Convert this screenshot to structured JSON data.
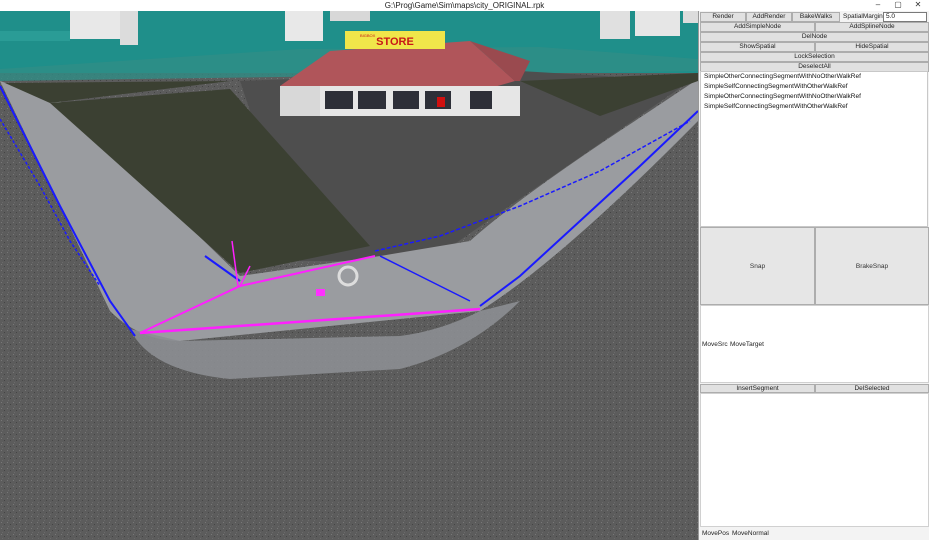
{
  "window": {
    "title": "G:\\Prog\\Game\\Sim\\maps\\city_ORIGINAL.rpk",
    "minimize": "–",
    "maximize": "▢",
    "close": "✕"
  },
  "scene": {
    "store_sign": "STORE",
    "store_sign_small": "BIGBOX"
  },
  "toolbar": {
    "render": "Render",
    "add_render": "AddRender",
    "bake_walks": "BakeWalks",
    "spatial_margin_label": "SpatialMargin:",
    "spatial_margin_value": "5.0",
    "add_simple_node": "AddSimpleNode",
    "add_spline_node": "AddSplineNode",
    "del_node": "DelNode",
    "show_spatial": "ShowSpatial",
    "hide_spatial": "HideSpatial",
    "lock_selection": "LockSelection",
    "deselect_all": "DeselectAll"
  },
  "list": {
    "items": [
      "SimpleOtherConnectingSegmentWithNoOtherWalkRef",
      "SimpleSelfConnectingSegmentWithOtherWalkRef",
      "SimpleOtherConnectingSegmentWithNoOtherWalkRef",
      "SimpleSelfConnectingSegmentWithOtherWalkRef"
    ]
  },
  "snap": {
    "snap": "Snap",
    "brake_snap": "BrakeSnap"
  },
  "move": {
    "move_src": "MoveSrc",
    "move_target": "MoveTarget"
  },
  "segment": {
    "insert_segment": "InsertSegment",
    "del_selected": "DelSelected"
  },
  "footer": {
    "move_pos": "MovePos",
    "move_normal": "MoveNormal"
  },
  "colors": {
    "sky": "#1f8f8a",
    "asphalt": "#5a5a5a",
    "grass": "#3b4032",
    "sidewalk": "#9a9ca0",
    "walk_blue": "#1a1aff",
    "walk_magenta": "#ff20ff",
    "roof": "#b0555a"
  }
}
